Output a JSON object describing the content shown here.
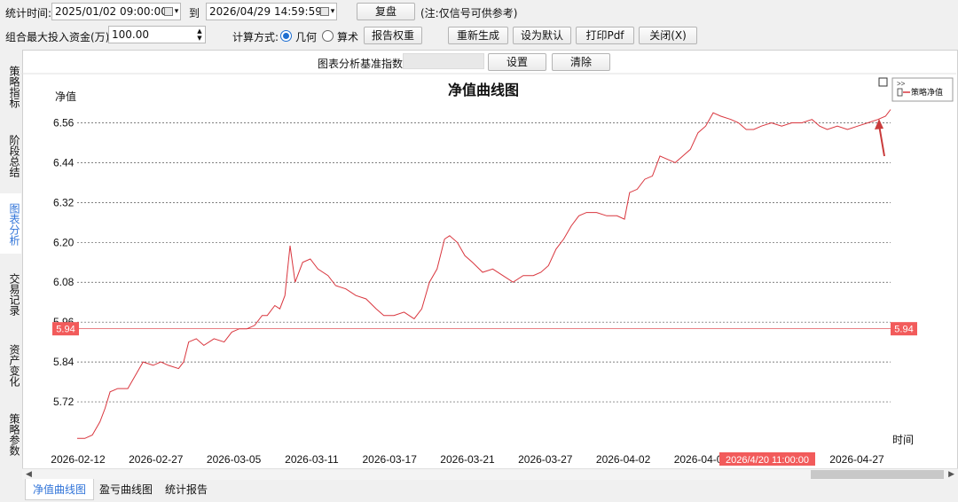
{
  "toolbar": {
    "stat_time_label": "统计时间:",
    "start_date": "2025/01/02 09:00:00",
    "to_label": "到",
    "end_date": "2026/04/29 14:59:59",
    "replay_button": "复盘",
    "replay_note": "(注:仅信号可供参考)",
    "max_capital_label": "组合最大投入资金(万):",
    "max_capital_value": "100.00",
    "calc_method_label": "计算方式:",
    "calc_geometric": "几何",
    "calc_arithmetic": "算术",
    "report_weight_button": "报告权重",
    "regenerate_button": "重新生成",
    "set_default_button": "设为默认",
    "print_pdf_button": "打印Pdf",
    "close_button": "关闭(X)"
  },
  "side_tabs": [
    {
      "label": "策略指标",
      "active": false
    },
    {
      "label": "阶段总结",
      "active": false
    },
    {
      "label": "图表分析",
      "active": true
    },
    {
      "label": "交易记录",
      "active": false
    },
    {
      "label": "资产变化",
      "active": false
    },
    {
      "label": "策略参数",
      "active": false
    }
  ],
  "chart_header": {
    "benchmark_label": "图表分析基准指数:",
    "benchmark_value": "",
    "settings_button": "设置",
    "clear_button": "清除"
  },
  "bottom_tabs": [
    {
      "label": "净值曲线图",
      "active": true
    },
    {
      "label": "盈亏曲线图",
      "active": false
    },
    {
      "label": "统计报告",
      "active": false
    }
  ],
  "legend": {
    "toggle": ">>",
    "item": "策略净值"
  },
  "crosshair": {
    "value_label": "5.94",
    "time_label": "2026/4/20 11:00:00"
  },
  "colors": {
    "line": "#d9363e",
    "crosshair_tag": "#f25b5b",
    "grid": "#555555"
  },
  "chart_data": {
    "type": "line",
    "title": "净值曲线图",
    "ylabel": "净值",
    "xlabel": "时间",
    "ylim": [
      5.6,
      6.62
    ],
    "y_ticks": [
      "6.56",
      "6.44",
      "6.32",
      "6.20",
      "6.08",
      "5.96",
      "5.84",
      "5.72"
    ],
    "x_ticks": [
      "2026-02-12",
      "2026-02-27",
      "2026-03-05",
      "2026-03-11",
      "2026-03-17",
      "2026-03-21",
      "2026-03-27",
      "2026-04-02",
      "2026-04-09",
      "2026-0",
      "2026-04-27"
    ],
    "grid": true,
    "legend_position": "top-right",
    "series": [
      {
        "name": "策略净值",
        "points": [
          [
            0,
            5.61
          ],
          [
            0.3,
            5.61
          ],
          [
            0.6,
            5.62
          ],
          [
            0.9,
            5.66
          ],
          [
            1.1,
            5.7
          ],
          [
            1.3,
            5.75
          ],
          [
            1.6,
            5.76
          ],
          [
            2.0,
            5.76
          ],
          [
            2.3,
            5.8
          ],
          [
            2.6,
            5.84
          ],
          [
            3.0,
            5.83
          ],
          [
            3.3,
            5.84
          ],
          [
            3.6,
            5.83
          ],
          [
            4.0,
            5.82
          ],
          [
            4.2,
            5.84
          ],
          [
            4.4,
            5.9
          ],
          [
            4.7,
            5.91
          ],
          [
            5.0,
            5.89
          ],
          [
            5.4,
            5.91
          ],
          [
            5.8,
            5.9
          ],
          [
            6.1,
            5.93
          ],
          [
            6.4,
            5.94
          ],
          [
            6.7,
            5.94
          ],
          [
            7.0,
            5.95
          ],
          [
            7.3,
            5.98
          ],
          [
            7.5,
            5.98
          ],
          [
            7.8,
            6.01
          ],
          [
            8.0,
            6.0
          ],
          [
            8.2,
            6.04
          ],
          [
            8.4,
            6.19
          ],
          [
            8.6,
            6.08
          ],
          [
            8.9,
            6.14
          ],
          [
            9.2,
            6.15
          ],
          [
            9.5,
            6.12
          ],
          [
            9.9,
            6.1
          ],
          [
            10.2,
            6.07
          ],
          [
            10.6,
            6.06
          ],
          [
            11.0,
            6.04
          ],
          [
            11.4,
            6.03
          ],
          [
            11.8,
            6.0
          ],
          [
            12.1,
            5.98
          ],
          [
            12.5,
            5.98
          ],
          [
            12.9,
            5.99
          ],
          [
            13.3,
            5.97
          ],
          [
            13.6,
            6.0
          ],
          [
            13.9,
            6.08
          ],
          [
            14.2,
            6.12
          ],
          [
            14.5,
            6.21
          ],
          [
            14.7,
            6.22
          ],
          [
            15.0,
            6.2
          ],
          [
            15.3,
            6.16
          ],
          [
            15.6,
            6.14
          ],
          [
            16.0,
            6.11
          ],
          [
            16.4,
            6.12
          ],
          [
            16.8,
            6.1
          ],
          [
            17.2,
            6.08
          ],
          [
            17.6,
            6.1
          ],
          [
            18.0,
            6.1
          ],
          [
            18.3,
            6.11
          ],
          [
            18.6,
            6.13
          ],
          [
            18.9,
            6.18
          ],
          [
            19.2,
            6.21
          ],
          [
            19.5,
            6.25
          ],
          [
            19.8,
            6.28
          ],
          [
            20.1,
            6.29
          ],
          [
            20.5,
            6.29
          ],
          [
            20.9,
            6.28
          ],
          [
            21.3,
            6.28
          ],
          [
            21.6,
            6.27
          ],
          [
            21.8,
            6.35
          ],
          [
            22.1,
            6.36
          ],
          [
            22.4,
            6.39
          ],
          [
            22.7,
            6.4
          ],
          [
            23.0,
            6.46
          ],
          [
            23.3,
            6.45
          ],
          [
            23.6,
            6.44
          ],
          [
            23.9,
            6.46
          ],
          [
            24.2,
            6.48
          ],
          [
            24.5,
            6.53
          ],
          [
            24.8,
            6.55
          ],
          [
            25.1,
            6.59
          ],
          [
            25.4,
            6.58
          ],
          [
            25.8,
            6.57
          ],
          [
            26.1,
            6.56
          ],
          [
            26.4,
            6.54
          ],
          [
            26.7,
            6.54
          ],
          [
            27.0,
            6.55
          ],
          [
            27.4,
            6.56
          ],
          [
            27.8,
            6.55
          ],
          [
            28.2,
            6.56
          ],
          [
            28.6,
            6.56
          ],
          [
            29.0,
            6.57
          ],
          [
            29.3,
            6.55
          ],
          [
            29.6,
            6.54
          ],
          [
            30.0,
            6.55
          ],
          [
            30.4,
            6.54
          ],
          [
            30.8,
            6.55
          ],
          [
            31.2,
            6.56
          ],
          [
            31.6,
            6.57
          ],
          [
            31.9,
            6.58
          ],
          [
            32.1,
            6.6
          ]
        ]
      }
    ]
  }
}
